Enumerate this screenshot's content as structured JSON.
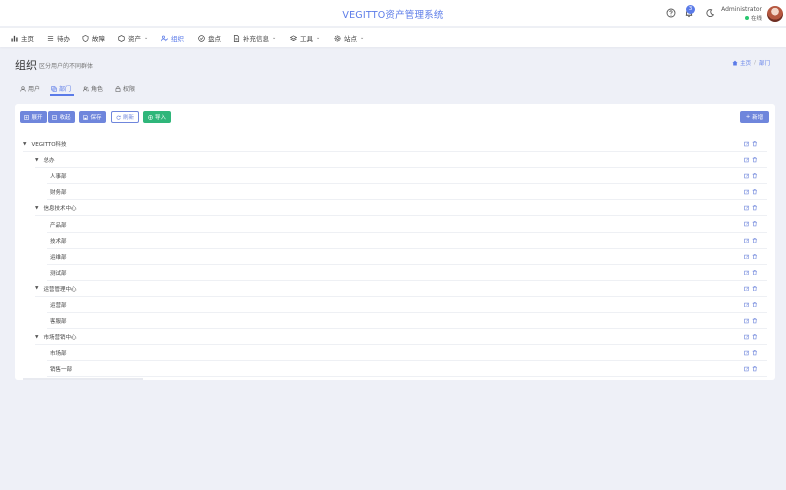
{
  "header": {
    "app_title": "VEGITTO资产管理系统",
    "badge_count": "3",
    "user_name": "Administrator",
    "user_status": "在线"
  },
  "nav": [
    {
      "label": "主页",
      "icon": "chart-icon"
    },
    {
      "label": "待办",
      "icon": "list-icon"
    },
    {
      "label": "故障",
      "icon": "shield-icon"
    },
    {
      "label": "资产",
      "icon": "box-icon",
      "caret": true
    },
    {
      "label": "组织",
      "icon": "org-icon",
      "active": true
    },
    {
      "label": "盘点",
      "icon": "check-circle-icon"
    },
    {
      "label": "补充信息",
      "icon": "document-icon",
      "caret": true
    },
    {
      "label": "工具",
      "icon": "layers-icon",
      "caret": true
    },
    {
      "label": "站点",
      "icon": "gear-icon",
      "caret": true
    }
  ],
  "page": {
    "title": "组织",
    "subtitle": "区分用户的不同群体"
  },
  "breadcrumb": {
    "home": "主页",
    "separator": "/",
    "current": "部门"
  },
  "tabs": [
    {
      "label": "用户",
      "icon": "user-icon"
    },
    {
      "label": "部门",
      "icon": "copy-icon",
      "active": true
    },
    {
      "label": "角色",
      "icon": "users-icon"
    },
    {
      "label": "权限",
      "icon": "lock-icon"
    }
  ],
  "toolbar": {
    "expand": "展开",
    "collapse": "收起",
    "save": "保存",
    "refresh": "刷新",
    "import": "导入",
    "add": "新增"
  },
  "tree": [
    {
      "label": "VEGITTO科技",
      "level": 0,
      "toggle": true
    },
    {
      "label": "总办",
      "level": 1,
      "toggle": true
    },
    {
      "label": "人事部",
      "level": 2
    },
    {
      "label": "财务部",
      "level": 2
    },
    {
      "label": "信息技术中心",
      "level": 1,
      "toggle": true
    },
    {
      "label": "产品部",
      "level": 2
    },
    {
      "label": "技术部",
      "level": 2
    },
    {
      "label": "运维部",
      "level": 2
    },
    {
      "label": "测试部",
      "level": 2
    },
    {
      "label": "运营管理中心",
      "level": 1,
      "toggle": true
    },
    {
      "label": "运营部",
      "level": 2
    },
    {
      "label": "客服部",
      "level": 2
    },
    {
      "label": "市场营销中心",
      "level": 1,
      "toggle": true
    },
    {
      "label": "市场部",
      "level": 2
    },
    {
      "label": "销售一部",
      "level": 2
    }
  ],
  "colors": {
    "accent": "#5b7be8",
    "button": "#6f86dc",
    "success": "#2fb67a",
    "background": "#eef0f7"
  }
}
